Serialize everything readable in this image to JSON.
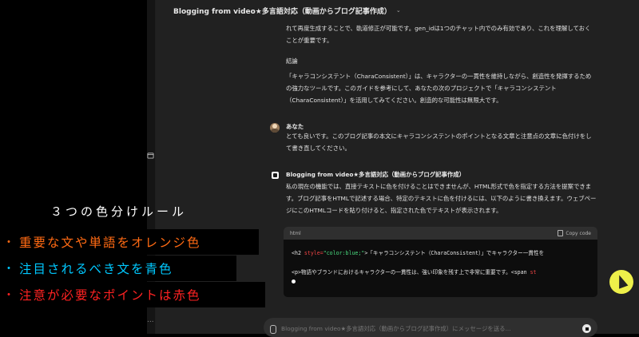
{
  "header": {
    "title": "Blogging from video★多言語対応（動画からブログ記事作成）"
  },
  "conversation": {
    "assistant_prev": {
      "para1": "れて再度生成することで、軌道修正が可能です。gen_idは1つのチャット内でのみ有効であり、これを理解しておくことが重要です。",
      "heading": "結論",
      "para2": "「キャラコンシステント（CharaConsistent）」は、キャラクターの一貫性を維持しながら、創造性を発揮するための強力なツールです。このガイドを参考にして、あなたの次のプロジェクトで「キャラコンシステント（CharaConsistent）」を活用してみてください。創造的な可能性は無限大です。"
    },
    "user": {
      "name": "あなた",
      "text": "とても良いです。このブログ記事の本文にキャラコンシステントのポイントとなる文章と注意点の文章に色付けをして書き直してください。"
    },
    "assistant": {
      "name": "Blogging from video★多言語対応（動画からブログ記事作成）",
      "text": "私の現在の機能では、直接テキストに色を付けることはできませんが、HTML形式で色を指定する方法を提案できます。ブログ記事をHTMLで記述する場合、特定のテキストに色を付けるには、以下のように書き換えます。ウェブページにこのHTMLコードを貼り付けると、指定された色でテキストが表示されます。",
      "code": {
        "language": "html",
        "copy_label": "Copy code",
        "line1_tag_open": "<h2 ",
        "line1_attr": "style=",
        "line1_str": "\"color:blue;\"",
        "line1_rest": ">「キャラコンシステント（CharaConsistent）」でキャラクター一貫性を",
        "line2_text": "<p>物語やブランドにおけるキャラクターの一貫性は、強い印象を残す上で非常に重要です。<span ",
        "line2_attr": "st"
      }
    }
  },
  "composer": {
    "placeholder": "Blogging from video★多言語対応（動画からブログ記事作成）にメッセージを送る..."
  },
  "overlay": {
    "title": "３つの色分けルール",
    "rules": [
      {
        "bullet": "・",
        "text": "重要な文や単語をオレンジ色",
        "color": "#ff6a13"
      },
      {
        "bullet": "・",
        "text": "注目されるべき文を青色",
        "color": "#00c8ff"
      },
      {
        "bullet": "・",
        "text": "注意が必要なポイントは赤色",
        "color": "#ff2222"
      }
    ]
  },
  "sidebar": {
    "more_label": "..."
  }
}
